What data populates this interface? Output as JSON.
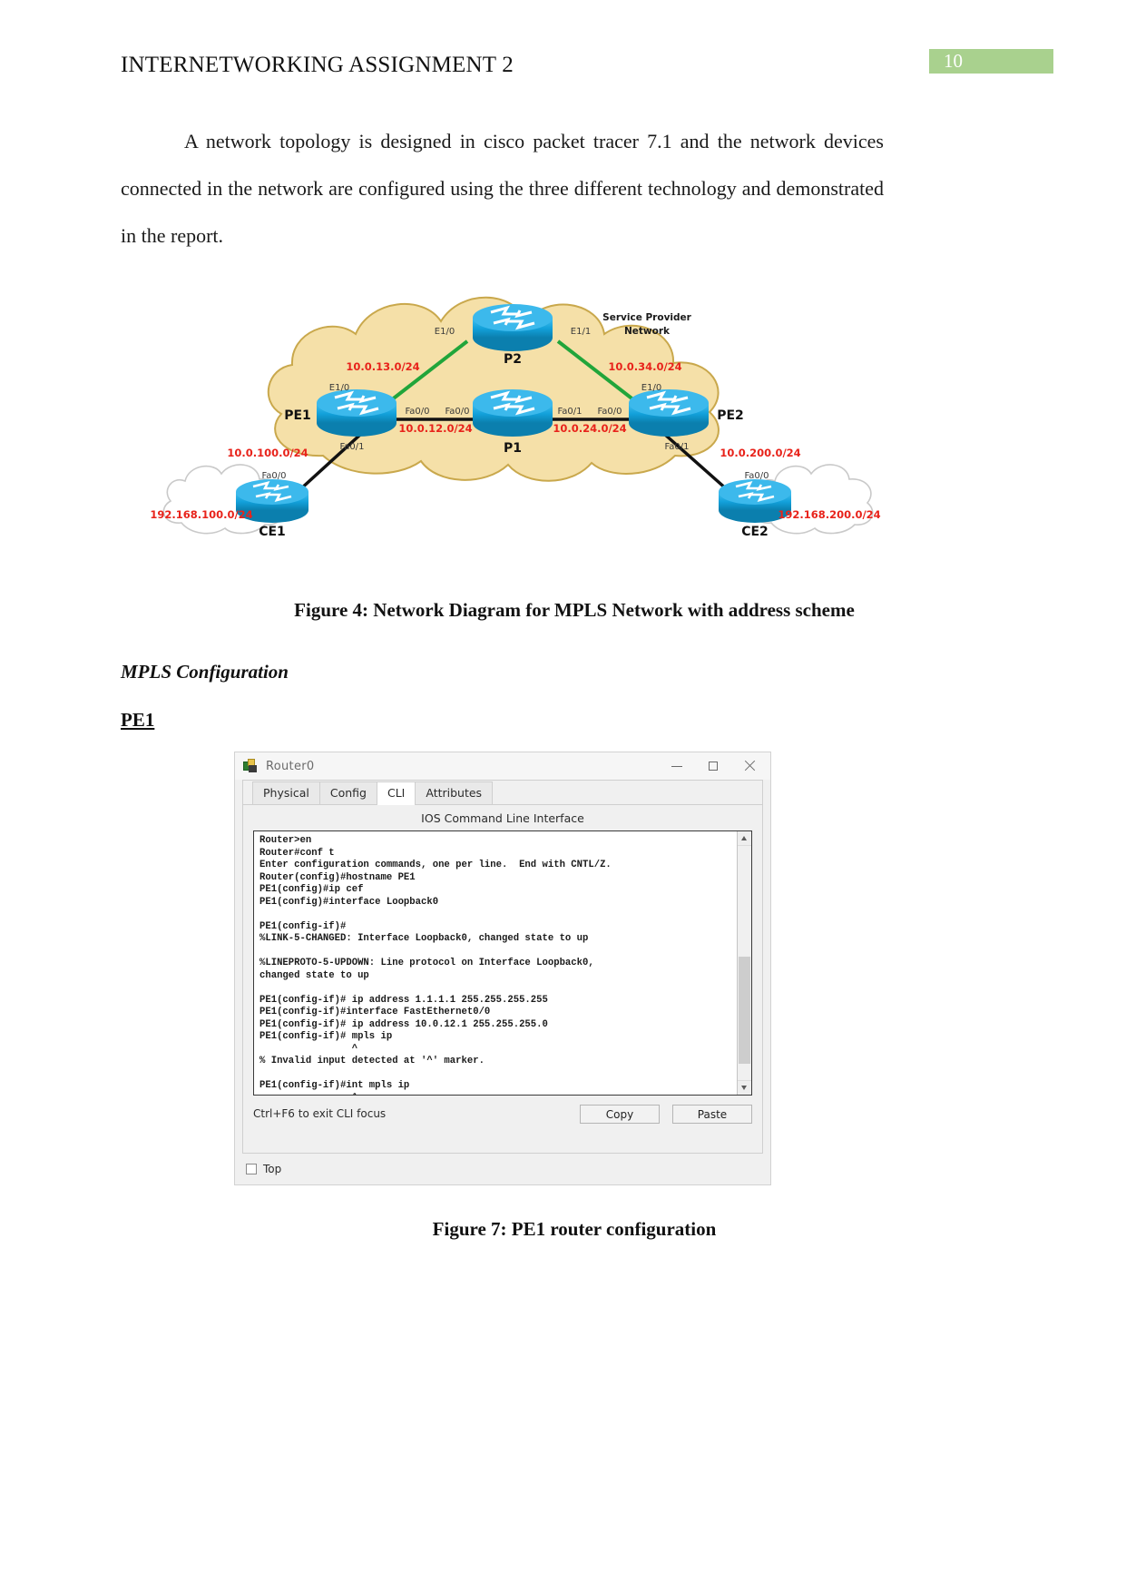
{
  "header": {
    "doc_title": "INTERNETWORKING ASSIGNMENT 2",
    "page_number": "10"
  },
  "intro": {
    "paragraph": "A network topology is designed in cisco packet tracer 7.1 and the network devices connected in the network are configured using the three different technology and demonstrated in the report."
  },
  "diagram": {
    "cloud_label_line1": "Service Provider",
    "cloud_label_line2": "Network",
    "routers": {
      "p2": "P2",
      "p1": "P1",
      "pe1": "PE1",
      "pe2": "PE2",
      "ce1": "CE1",
      "ce2": "CE2"
    },
    "interfaces": {
      "p2_left": "E1/0",
      "p2_right": "E1/1",
      "pe1_up": "E1/0",
      "pe2_up": "E1/0",
      "pe1_right": "Fa0/0",
      "p1_left": "Fa0/0",
      "p1_right": "Fa0/1",
      "pe2_left": "Fa0/0",
      "pe1_down": "Fa0/1",
      "pe2_down": "Fa0/1",
      "ce1_up": "Fa0/0",
      "ce2_up": "Fa0/0"
    },
    "subnets": {
      "pe1_p2": "10.0.13.0/24",
      "p2_pe2": "10.0.34.0/24",
      "pe1_p1": "10.0.12.0/24",
      "p1_pe2": "10.0.24.0/24",
      "pe1_ce1": "10.0.100.0/24",
      "pe2_ce2": "10.0.200.0/24",
      "ce1_lan": "192.168.100.0/24",
      "ce2_lan": "192.168.200.0/24"
    },
    "colors": {
      "cloud_fill": "#f5e0a8",
      "cloud_stroke": "#c9a84c",
      "subnet_text": "#e8231b",
      "link_green": "#21a53a",
      "link_black": "#111111",
      "router_body": "#1a9fd4"
    }
  },
  "figure4": {
    "caption": "Figure 4: Network Diagram for MPLS Network with address scheme"
  },
  "sections": {
    "mpls_configuration": "MPLS Configuration",
    "pe1": "PE1"
  },
  "packet_tracer": {
    "window_title": "Router0",
    "window_buttons": {
      "minimize": "minimize-icon",
      "maximize": "maximize-icon",
      "close": "close-icon"
    },
    "tabs": [
      {
        "label": "Physical",
        "active": false
      },
      {
        "label": "Config",
        "active": false
      },
      {
        "label": "CLI",
        "active": true
      },
      {
        "label": "Attributes",
        "active": false
      }
    ],
    "panel_title": "IOS Command Line Interface",
    "terminal_text": "Router>en\nRouter#conf t\nEnter configuration commands, one per line.  End with CNTL/Z.\nRouter(config)#hostname PE1\nPE1(config)#ip cef\nPE1(config)#interface Loopback0\n\nPE1(config-if)#\n%LINK-5-CHANGED: Interface Loopback0, changed state to up\n\n%LINEPROTO-5-UPDOWN: Line protocol on Interface Loopback0,\nchanged state to up\n\nPE1(config-if)# ip address 1.1.1.1 255.255.255.255\nPE1(config-if)#interface FastEthernet0/0\nPE1(config-if)# ip address 10.0.12.1 255.255.255.0\nPE1(config-if)# mpls ip\n                ^\n% Invalid input detected at '^' marker.\n\nPE1(config-if)#int mpls ip\n                ^\n% Invalid input detected at '^' marker.",
    "hint_text": "Ctrl+F6 to exit CLI focus",
    "copy_button": "Copy",
    "paste_button": "Paste",
    "top_checkbox_label": "Top"
  },
  "figure7": {
    "caption": "Figure 7: PE1 router configuration"
  }
}
